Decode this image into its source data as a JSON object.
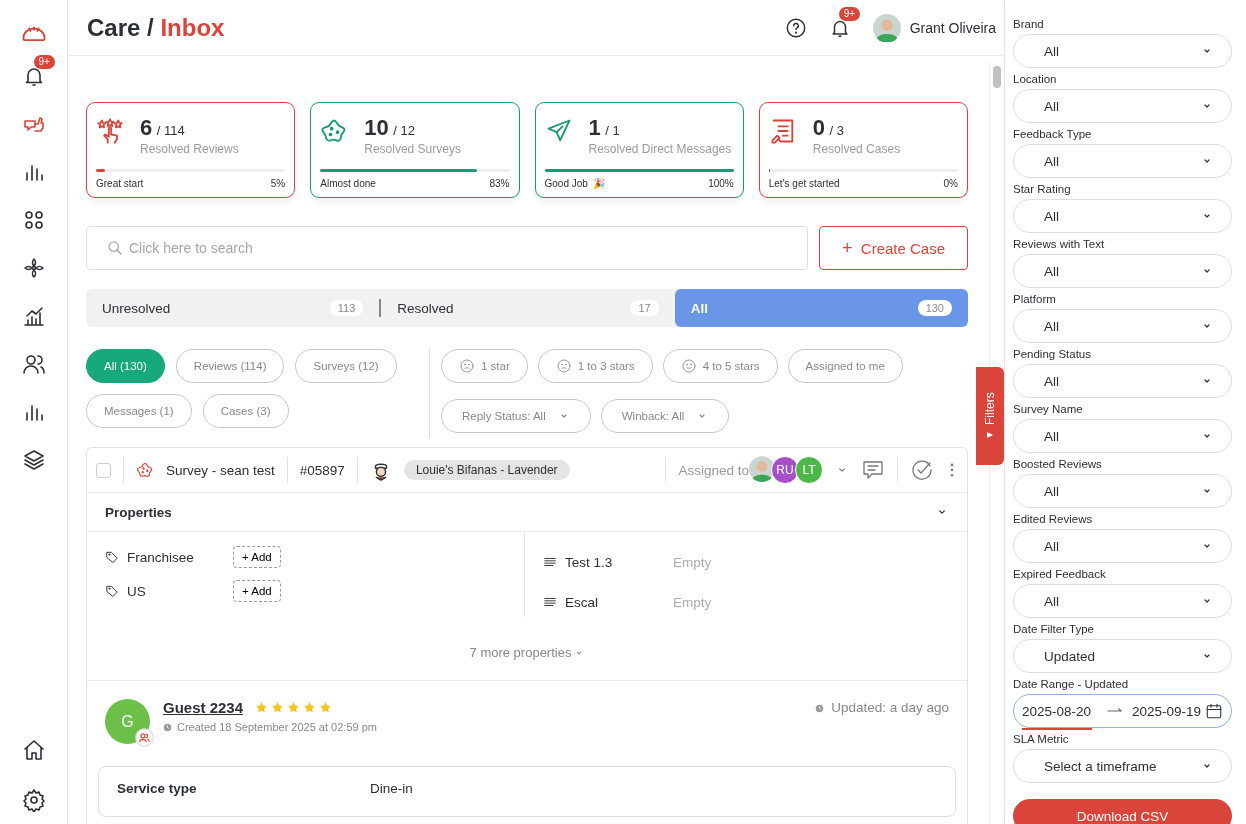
{
  "nav": {
    "items": [
      {
        "kind": "bell",
        "badge": "9+",
        "selected": false
      },
      {
        "kind": "thumbs",
        "selected": true
      },
      {
        "kind": "bars",
        "selected": false
      },
      {
        "kind": "grid",
        "selected": false
      },
      {
        "kind": "flower",
        "selected": false
      },
      {
        "kind": "analytics",
        "selected": false
      },
      {
        "kind": "users",
        "selected": false
      },
      {
        "kind": "bars",
        "selected": false
      },
      {
        "kind": "layers",
        "selected": false
      }
    ],
    "bottom": [
      {
        "kind": "home",
        "selected": false
      },
      {
        "kind": "gear",
        "selected": false
      }
    ]
  },
  "header": {
    "section": "Care",
    "separator": "/",
    "page": "Inbox",
    "notifications": "9+",
    "user": "Grant Oliveira"
  },
  "stats": [
    {
      "kind": "reviews",
      "value": "6",
      "total": "/ 114",
      "label": "Resolved Reviews",
      "status": "Great start",
      "percent": "5%",
      "level": 0.05,
      "color": "#d9453b"
    },
    {
      "kind": "surveys",
      "value": "10",
      "total": "/ 12",
      "label": "Resolved Surveys",
      "status": "Almost done",
      "percent": "83%",
      "level": 0.83,
      "color": "#1a9b72"
    },
    {
      "kind": "messages",
      "value": "1",
      "total": "/ 1",
      "label": "Resolved Direct Messages",
      "status": "Good Job",
      "emoji": "🎉",
      "percent": "100%",
      "level": 1,
      "color": "#1a9b72"
    },
    {
      "kind": "cases",
      "value": "0",
      "total": "/ 3",
      "label": "Resolved Cases",
      "status": "Let's get started",
      "percent": "0%",
      "level": 0,
      "color": "#d9453b"
    }
  ],
  "search": {
    "placeholder": "Click here to search"
  },
  "create_button": {
    "icon": "+",
    "label": "Create Case"
  },
  "tabs": [
    {
      "label": "Unresolved",
      "count": "113",
      "selected": false
    },
    {
      "label": "Resolved",
      "count": "17",
      "selected": false
    },
    {
      "label": "All",
      "count": "130",
      "selected": true
    }
  ],
  "type_chips": [
    {
      "label": "All (130)",
      "selected": true
    },
    {
      "label": "Reviews (114)",
      "selected": false
    },
    {
      "label": "Surveys (12)",
      "selected": false
    },
    {
      "label": "Messages (1)",
      "selected": false
    },
    {
      "label": "Cases (3)",
      "selected": false
    }
  ],
  "filter_chips": [
    {
      "kind": "sad",
      "label": "1 star"
    },
    {
      "kind": "sad",
      "label": "1 to 3 stars"
    },
    {
      "kind": "happy",
      "label": "4 to 5 stars"
    },
    {
      "kind": "plain",
      "label": "Assigned to me"
    },
    {
      "kind": "dropdown",
      "label": "Reply Status: All"
    },
    {
      "kind": "dropdown",
      "label": "Winback: All"
    }
  ],
  "case": {
    "checked": false,
    "title": "Survey - sean test",
    "number": "#05897",
    "location": "Louie's Bifanas - Lavender",
    "assigned_label": "Assigned to",
    "assignees": [
      {
        "kind": "photo"
      },
      {
        "kind": "initials",
        "initials": "RU",
        "color": "#a64fc8"
      },
      {
        "kind": "initials",
        "initials": "LT",
        "color": "#4cb84a"
      }
    ]
  },
  "properties": {
    "title": "Properties",
    "expanded": true,
    "tags": [
      {
        "label": "Franchisee",
        "button": "+ Add"
      },
      {
        "label": "US",
        "button": "+ Add"
      }
    ],
    "fields": [
      {
        "label": "Test 1.3",
        "value": "Empty"
      },
      {
        "label": "Escal",
        "value": "Empty"
      }
    ],
    "more": "7 more properties"
  },
  "review": {
    "initial": "G",
    "name": "Guest 2234",
    "stars": 5,
    "created": "Created 18 September 2025 at 02:59 pm",
    "updated": "Updated: a day ago",
    "details": [
      {
        "label": "Service type",
        "value": "Dine-in"
      }
    ]
  },
  "filters_tab": "Filters",
  "filters": [
    {
      "label": "Brand",
      "kind": "select",
      "value": "All"
    },
    {
      "label": "Location",
      "kind": "select",
      "value": "All"
    },
    {
      "label": "Feedback Type",
      "kind": "select",
      "value": "All"
    },
    {
      "label": "Star Rating",
      "kind": "select",
      "value": "All"
    },
    {
      "label": "Reviews with Text",
      "kind": "select",
      "value": "All"
    },
    {
      "label": "Platform",
      "kind": "select",
      "value": "All"
    },
    {
      "label": "Pending Status",
      "kind": "select",
      "value": "All"
    },
    {
      "label": "Survey Name",
      "kind": "select",
      "value": "All"
    },
    {
      "label": "Boosted Reviews",
      "kind": "select",
      "value": "All"
    },
    {
      "label": "Edited Reviews",
      "kind": "select",
      "value": "All"
    },
    {
      "label": "Expired Feedback",
      "kind": "select",
      "value": "All"
    },
    {
      "label": "Date Filter Type",
      "kind": "select",
      "value": "Updated"
    },
    {
      "label": "Date Range - Updated",
      "kind": "date",
      "start": "2025-08-20",
      "end": "2025-09-19",
      "focused": true
    },
    {
      "label": "SLA Metric",
      "kind": "select",
      "placeholder": "Select a timeframe"
    }
  ],
  "download_button": "Download CSV"
}
